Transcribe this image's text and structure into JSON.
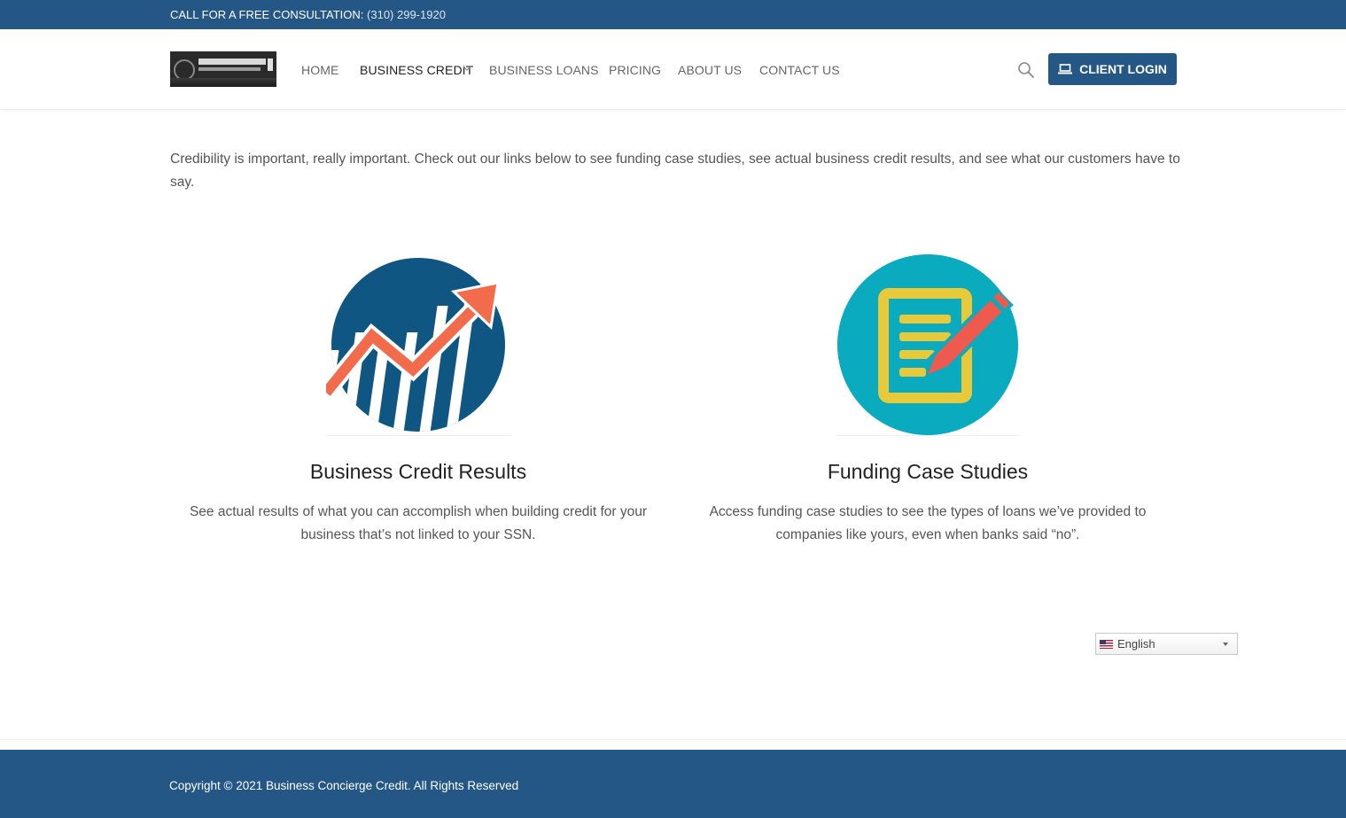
{
  "topbar": {
    "label": "CALL FOR A FREE CONSULTATION:",
    "phone": "(310) 299-1920"
  },
  "header": {
    "logo": "logo",
    "nav": [
      {
        "label": "HOME"
      },
      {
        "label": "BUSINESS CREDIT"
      },
      {
        "label": "BUSINESS LOANS"
      },
      {
        "label": "PRICING"
      },
      {
        "label": "ABOUT US"
      },
      {
        "label": "CONTACT US"
      }
    ],
    "login_label": "CLIENT LOGIN"
  },
  "main": {
    "intro": "Credibility is important, really important.  Check out our links below to see funding case studies, see actual business credit results, and see what our customers have to say.",
    "cards": [
      {
        "title": "Business Credit Results",
        "text": "See actual results of what you can accomplish when building credit for your business that’s not linked to your SSN.",
        "icon": "growth-chart-icon"
      },
      {
        "title": "Funding Case Studies",
        "text": "Access funding case studies to see the types of loans we’ve provided to companies like yours, even when banks said “no”.",
        "icon": "document-pencil-icon"
      }
    ]
  },
  "language": {
    "selected": "English"
  },
  "footer": {
    "copyright": "Copyright © 2021 Business Concierge Credit. All Rights Reserved"
  },
  "colors": {
    "brand": "#245785",
    "chart_circle": "#0f5782",
    "arrow": "#f26b4a",
    "teal": "#0aaabf",
    "doc_yellow": "#e8c93a",
    "pencil": "#ee5a4d"
  }
}
